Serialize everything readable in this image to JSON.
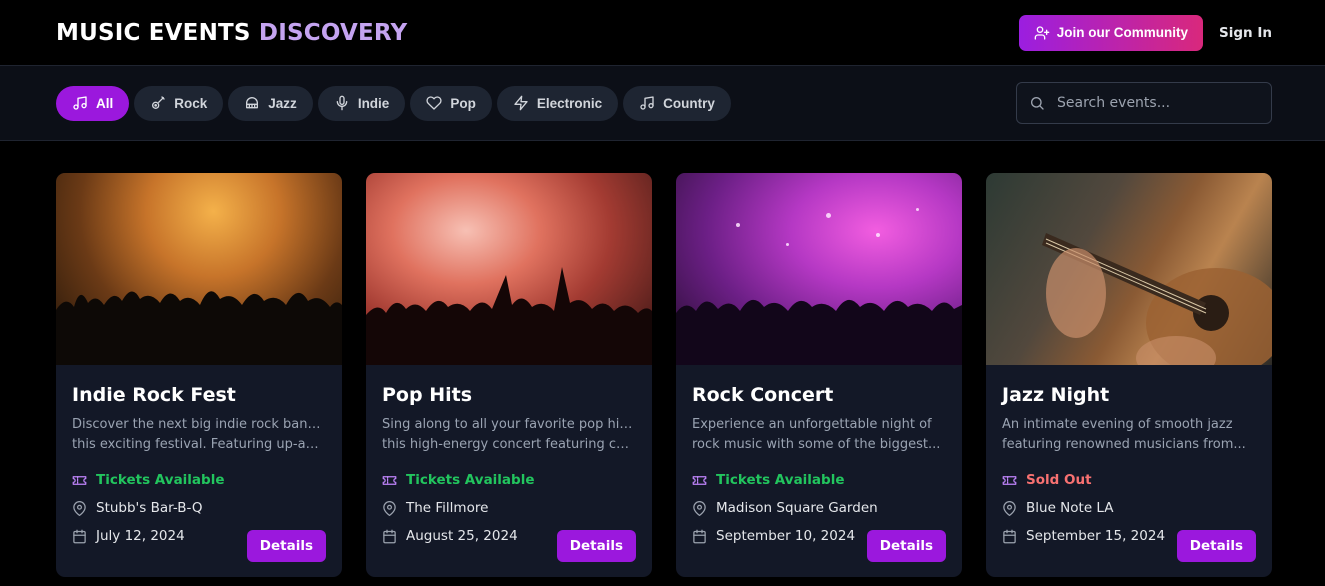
{
  "header": {
    "brand_part1": "MUSIC EVENTS",
    "brand_part2": "DISCOVERY",
    "join_label": "Join our Community",
    "sign_in_label": "Sign In"
  },
  "filters": {
    "chips": [
      {
        "label": "All",
        "icon": "music-note-icon",
        "active": true
      },
      {
        "label": "Rock",
        "icon": "guitar-icon",
        "active": false
      },
      {
        "label": "Jazz",
        "icon": "piano-icon",
        "active": false
      },
      {
        "label": "Indie",
        "icon": "microphone-icon",
        "active": false
      },
      {
        "label": "Pop",
        "icon": "heart-icon",
        "active": false
      },
      {
        "label": "Electronic",
        "icon": "lightning-icon",
        "active": false
      },
      {
        "label": "Country",
        "icon": "music-note-icon",
        "active": false
      }
    ],
    "search_placeholder": "Search events..."
  },
  "events": [
    {
      "title": "Indie Rock Fest",
      "desc_line1": "Discover the next big indie rock bands at",
      "desc_line2": "this exciting festival. Featuring up-and-...",
      "status": "Tickets Available",
      "venue": "Stubb's Bar-B-Q",
      "date": "July 12, 2024",
      "details_label": "Details"
    },
    {
      "title": "Pop Hits",
      "desc_line1": "Sing along to all your favorite pop hits in",
      "desc_line2": "this high-energy concert featuring char...",
      "status": "Tickets Available",
      "venue": "The Fillmore",
      "date": "August 25, 2024",
      "details_label": "Details"
    },
    {
      "title": "Rock Concert",
      "desc_line1": "Experience an unforgettable night of",
      "desc_line2": "rock music with some of the biggest...",
      "status": "Tickets Available",
      "venue": "Madison Square Garden",
      "date": "September 10, 2024",
      "details_label": "Details"
    },
    {
      "title": "Jazz Night",
      "desc_line1": "An intimate evening of smooth jazz",
      "desc_line2": "featuring renowned musicians from...",
      "status": "Sold Out",
      "venue": "Blue Note LA",
      "date": "September 15, 2024",
      "details_label": "Details"
    }
  ],
  "colors": {
    "accent": "#9b18dd",
    "gradient_start": "#9b1ee0",
    "gradient_end": "#d9287c",
    "available": "#22c55e",
    "sold_out": "#f87171",
    "icon_purple": "#c084fc"
  }
}
